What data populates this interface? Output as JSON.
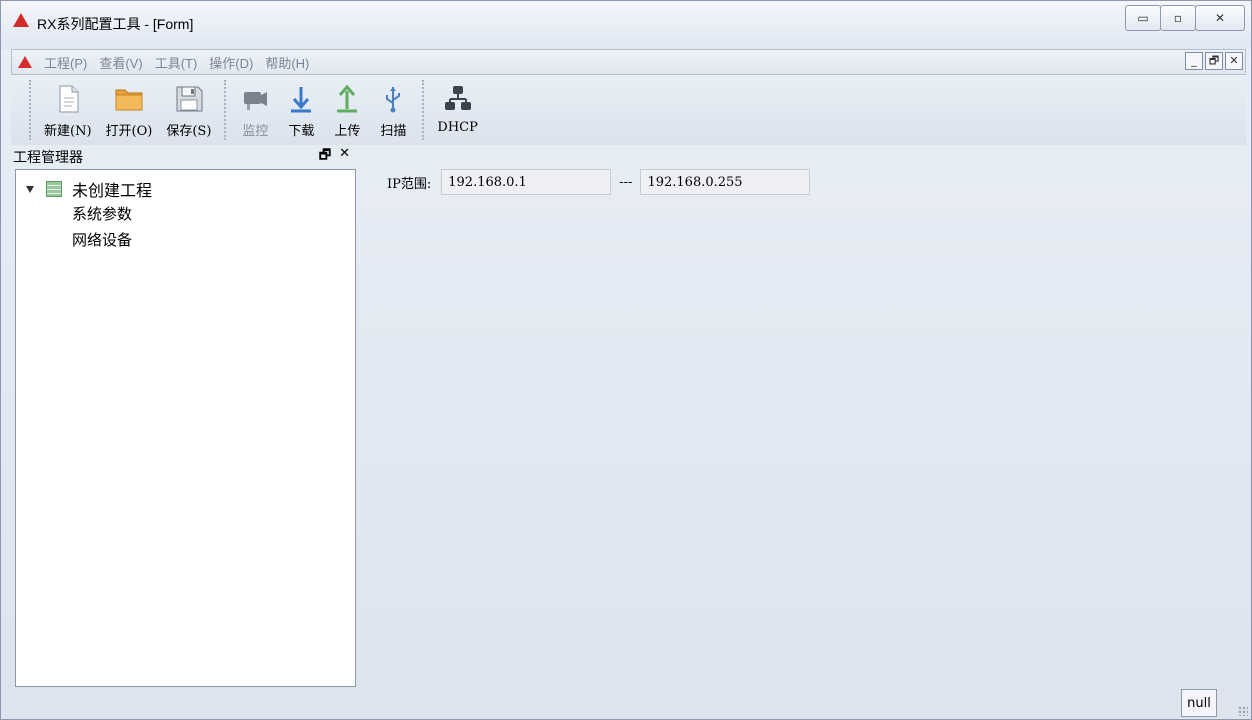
{
  "window": {
    "title": "RX系列配置工具 - [Form]",
    "controls": {
      "minimize": "▭",
      "maximize": "▫",
      "close": "✕"
    }
  },
  "menu": {
    "items": [
      "工程(P)",
      "查看(V)",
      "工具(T)",
      "操作(D)",
      "帮助(H)"
    ],
    "mdi_controls": {
      "minimize": "_",
      "restore": "🗗",
      "close": "✕"
    }
  },
  "toolbar": {
    "new_label": "新建(N)",
    "open_label": "打开(O)",
    "save_label": "保存(S)",
    "monitor_label": "监控",
    "download_label": "下载",
    "upload_label": "上传",
    "scan_label": "扫描",
    "dhcp_label": "DHCP"
  },
  "project_panel": {
    "title": "工程管理器",
    "controls": {
      "float": "🗗",
      "close": "✕"
    },
    "root_label": "未创建工程",
    "children": [
      "系统参数",
      "网络设备"
    ]
  },
  "ip_range": {
    "label": "IP范围:",
    "start": "192.168.0.1",
    "separator": "---",
    "end": "192.168.0.255"
  },
  "status": {
    "null_button": "null"
  }
}
